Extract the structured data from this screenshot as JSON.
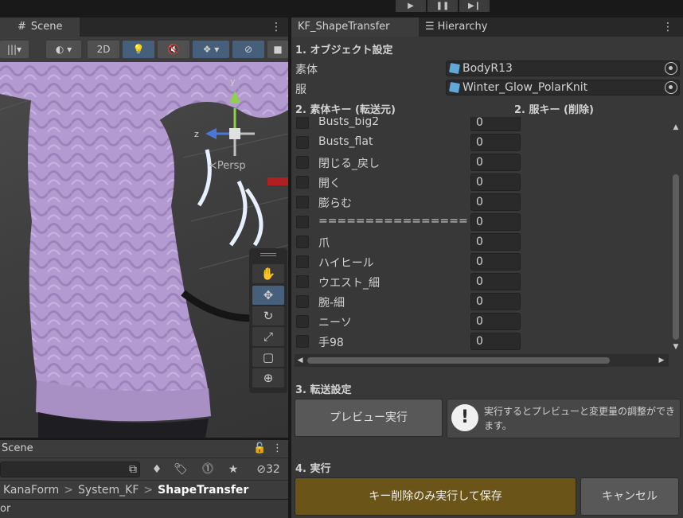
{
  "playbar": {
    "play_icon": "play-icon",
    "pause_icon": "pause-icon",
    "step_icon": "step-icon",
    "play_glyph": "▶",
    "pause_glyph": "❚❚",
    "step_glyph": "▶❙"
  },
  "scene": {
    "tab_label": "Scene",
    "tab_glyph": "#",
    "toolbar": {
      "btn_2d": "2D",
      "draw_mode_glyph": "◐",
      "light_glyph": "💡",
      "audio_glyph": "🔇",
      "fx_glyph": "❖",
      "hidden_glyph": "⊘",
      "camera_glyph": "■"
    },
    "gizmo": {
      "y_label": "y",
      "z_label": "z",
      "persp_label": "≺Persp"
    },
    "tools": [
      "✋",
      "✥",
      "↻",
      "⤢",
      "▢",
      "⊕"
    ]
  },
  "hierarchy_lower": {
    "tab_label": "Scene",
    "visibility_count": "32",
    "breadcrumb": [
      "KanaForm",
      "System_KF",
      "ShapeTransfer"
    ],
    "status_text": "or"
  },
  "inspector": {
    "tabs": [
      {
        "label": "KF_ShapeTransfer",
        "glyph": ""
      },
      {
        "label": "Hierarchy",
        "glyph": "☰"
      }
    ],
    "section1_title": "1. オブジェクト設定",
    "body_label": "素体",
    "body_value": "BodyR13",
    "clothes_label": "服",
    "clothes_value": "Winter_Glow_PolarKnit",
    "section2_left": "2. 素体キー (転送元)",
    "section2_right": "2. 服キー (削除)",
    "keys": [
      {
        "name": "Busts_big2",
        "value": "0"
      },
      {
        "name": "Busts_flat",
        "value": "0"
      },
      {
        "name": "閉じる_戻し",
        "value": "0"
      },
      {
        "name": "開く",
        "value": "0"
      },
      {
        "name": "膨らむ",
        "value": "0"
      },
      {
        "name": "================",
        "value": "0"
      },
      {
        "name": "爪",
        "value": "0"
      },
      {
        "name": "ハイヒール",
        "value": "0"
      },
      {
        "name": "ウエスト_細",
        "value": "0"
      },
      {
        "name": "腕-細",
        "value": "0"
      },
      {
        "name": "ニーソ",
        "value": "0"
      },
      {
        "name": "手98",
        "value": "0"
      }
    ],
    "section3_title": "3. 転送設定",
    "preview_button": "プレビュー実行",
    "help_text": "実行するとプレビューと変更量の調整ができます。",
    "section4_title": "4. 実行",
    "execute_button": "キー削除のみ実行して保存",
    "cancel_button": "キャンセル"
  },
  "colors": {
    "accent_blue": "#46607c",
    "execute_gold": "#6b5418",
    "sweater_purple": "#b39ad0"
  }
}
